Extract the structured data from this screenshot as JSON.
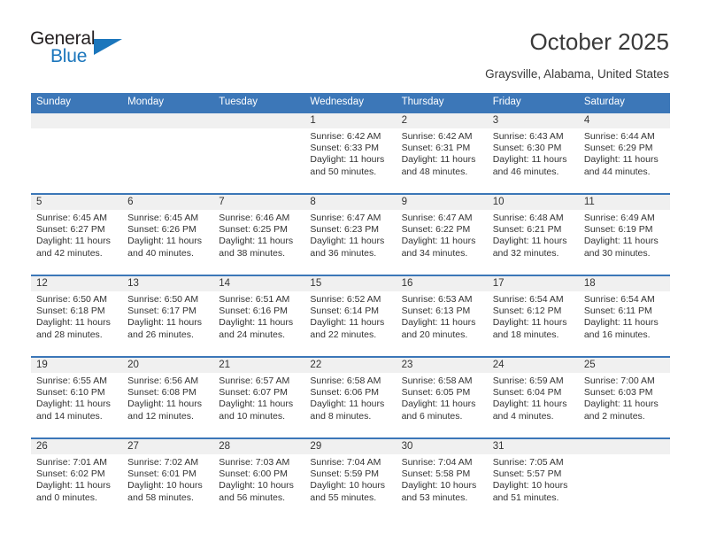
{
  "brand": {
    "name_top": "General",
    "name_bottom": "Blue",
    "triangle_icon": "triangle-icon",
    "color_dark": "#231f20",
    "color_blue": "#1b76bc"
  },
  "header": {
    "title": "October 2025",
    "subtitle": "Graysville, Alabama, United States"
  },
  "theme": {
    "header_blue": "#3c77b8",
    "daynum_bg": "#f0f0f0",
    "text": "#333333"
  },
  "calendar": {
    "weekdays": [
      "Sunday",
      "Monday",
      "Tuesday",
      "Wednesday",
      "Thursday",
      "Friday",
      "Saturday"
    ],
    "weeks": [
      [
        {
          "day": "",
          "sunrise": "",
          "sunset": "",
          "daylight": ""
        },
        {
          "day": "",
          "sunrise": "",
          "sunset": "",
          "daylight": ""
        },
        {
          "day": "",
          "sunrise": "",
          "sunset": "",
          "daylight": ""
        },
        {
          "day": "1",
          "sunrise": "Sunrise: 6:42 AM",
          "sunset": "Sunset: 6:33 PM",
          "daylight": "Daylight: 11 hours and 50 minutes."
        },
        {
          "day": "2",
          "sunrise": "Sunrise: 6:42 AM",
          "sunset": "Sunset: 6:31 PM",
          "daylight": "Daylight: 11 hours and 48 minutes."
        },
        {
          "day": "3",
          "sunrise": "Sunrise: 6:43 AM",
          "sunset": "Sunset: 6:30 PM",
          "daylight": "Daylight: 11 hours and 46 minutes."
        },
        {
          "day": "4",
          "sunrise": "Sunrise: 6:44 AM",
          "sunset": "Sunset: 6:29 PM",
          "daylight": "Daylight: 11 hours and 44 minutes."
        }
      ],
      [
        {
          "day": "5",
          "sunrise": "Sunrise: 6:45 AM",
          "sunset": "Sunset: 6:27 PM",
          "daylight": "Daylight: 11 hours and 42 minutes."
        },
        {
          "day": "6",
          "sunrise": "Sunrise: 6:45 AM",
          "sunset": "Sunset: 6:26 PM",
          "daylight": "Daylight: 11 hours and 40 minutes."
        },
        {
          "day": "7",
          "sunrise": "Sunrise: 6:46 AM",
          "sunset": "Sunset: 6:25 PM",
          "daylight": "Daylight: 11 hours and 38 minutes."
        },
        {
          "day": "8",
          "sunrise": "Sunrise: 6:47 AM",
          "sunset": "Sunset: 6:23 PM",
          "daylight": "Daylight: 11 hours and 36 minutes."
        },
        {
          "day": "9",
          "sunrise": "Sunrise: 6:47 AM",
          "sunset": "Sunset: 6:22 PM",
          "daylight": "Daylight: 11 hours and 34 minutes."
        },
        {
          "day": "10",
          "sunrise": "Sunrise: 6:48 AM",
          "sunset": "Sunset: 6:21 PM",
          "daylight": "Daylight: 11 hours and 32 minutes."
        },
        {
          "day": "11",
          "sunrise": "Sunrise: 6:49 AM",
          "sunset": "Sunset: 6:19 PM",
          "daylight": "Daylight: 11 hours and 30 minutes."
        }
      ],
      [
        {
          "day": "12",
          "sunrise": "Sunrise: 6:50 AM",
          "sunset": "Sunset: 6:18 PM",
          "daylight": "Daylight: 11 hours and 28 minutes."
        },
        {
          "day": "13",
          "sunrise": "Sunrise: 6:50 AM",
          "sunset": "Sunset: 6:17 PM",
          "daylight": "Daylight: 11 hours and 26 minutes."
        },
        {
          "day": "14",
          "sunrise": "Sunrise: 6:51 AM",
          "sunset": "Sunset: 6:16 PM",
          "daylight": "Daylight: 11 hours and 24 minutes."
        },
        {
          "day": "15",
          "sunrise": "Sunrise: 6:52 AM",
          "sunset": "Sunset: 6:14 PM",
          "daylight": "Daylight: 11 hours and 22 minutes."
        },
        {
          "day": "16",
          "sunrise": "Sunrise: 6:53 AM",
          "sunset": "Sunset: 6:13 PM",
          "daylight": "Daylight: 11 hours and 20 minutes."
        },
        {
          "day": "17",
          "sunrise": "Sunrise: 6:54 AM",
          "sunset": "Sunset: 6:12 PM",
          "daylight": "Daylight: 11 hours and 18 minutes."
        },
        {
          "day": "18",
          "sunrise": "Sunrise: 6:54 AM",
          "sunset": "Sunset: 6:11 PM",
          "daylight": "Daylight: 11 hours and 16 minutes."
        }
      ],
      [
        {
          "day": "19",
          "sunrise": "Sunrise: 6:55 AM",
          "sunset": "Sunset: 6:10 PM",
          "daylight": "Daylight: 11 hours and 14 minutes."
        },
        {
          "day": "20",
          "sunrise": "Sunrise: 6:56 AM",
          "sunset": "Sunset: 6:08 PM",
          "daylight": "Daylight: 11 hours and 12 minutes."
        },
        {
          "day": "21",
          "sunrise": "Sunrise: 6:57 AM",
          "sunset": "Sunset: 6:07 PM",
          "daylight": "Daylight: 11 hours and 10 minutes."
        },
        {
          "day": "22",
          "sunrise": "Sunrise: 6:58 AM",
          "sunset": "Sunset: 6:06 PM",
          "daylight": "Daylight: 11 hours and 8 minutes."
        },
        {
          "day": "23",
          "sunrise": "Sunrise: 6:58 AM",
          "sunset": "Sunset: 6:05 PM",
          "daylight": "Daylight: 11 hours and 6 minutes."
        },
        {
          "day": "24",
          "sunrise": "Sunrise: 6:59 AM",
          "sunset": "Sunset: 6:04 PM",
          "daylight": "Daylight: 11 hours and 4 minutes."
        },
        {
          "day": "25",
          "sunrise": "Sunrise: 7:00 AM",
          "sunset": "Sunset: 6:03 PM",
          "daylight": "Daylight: 11 hours and 2 minutes."
        }
      ],
      [
        {
          "day": "26",
          "sunrise": "Sunrise: 7:01 AM",
          "sunset": "Sunset: 6:02 PM",
          "daylight": "Daylight: 11 hours and 0 minutes."
        },
        {
          "day": "27",
          "sunrise": "Sunrise: 7:02 AM",
          "sunset": "Sunset: 6:01 PM",
          "daylight": "Daylight: 10 hours and 58 minutes."
        },
        {
          "day": "28",
          "sunrise": "Sunrise: 7:03 AM",
          "sunset": "Sunset: 6:00 PM",
          "daylight": "Daylight: 10 hours and 56 minutes."
        },
        {
          "day": "29",
          "sunrise": "Sunrise: 7:04 AM",
          "sunset": "Sunset: 5:59 PM",
          "daylight": "Daylight: 10 hours and 55 minutes."
        },
        {
          "day": "30",
          "sunrise": "Sunrise: 7:04 AM",
          "sunset": "Sunset: 5:58 PM",
          "daylight": "Daylight: 10 hours and 53 minutes."
        },
        {
          "day": "31",
          "sunrise": "Sunrise: 7:05 AM",
          "sunset": "Sunset: 5:57 PM",
          "daylight": "Daylight: 10 hours and 51 minutes."
        },
        {
          "day": "",
          "sunrise": "",
          "sunset": "",
          "daylight": ""
        }
      ]
    ]
  }
}
